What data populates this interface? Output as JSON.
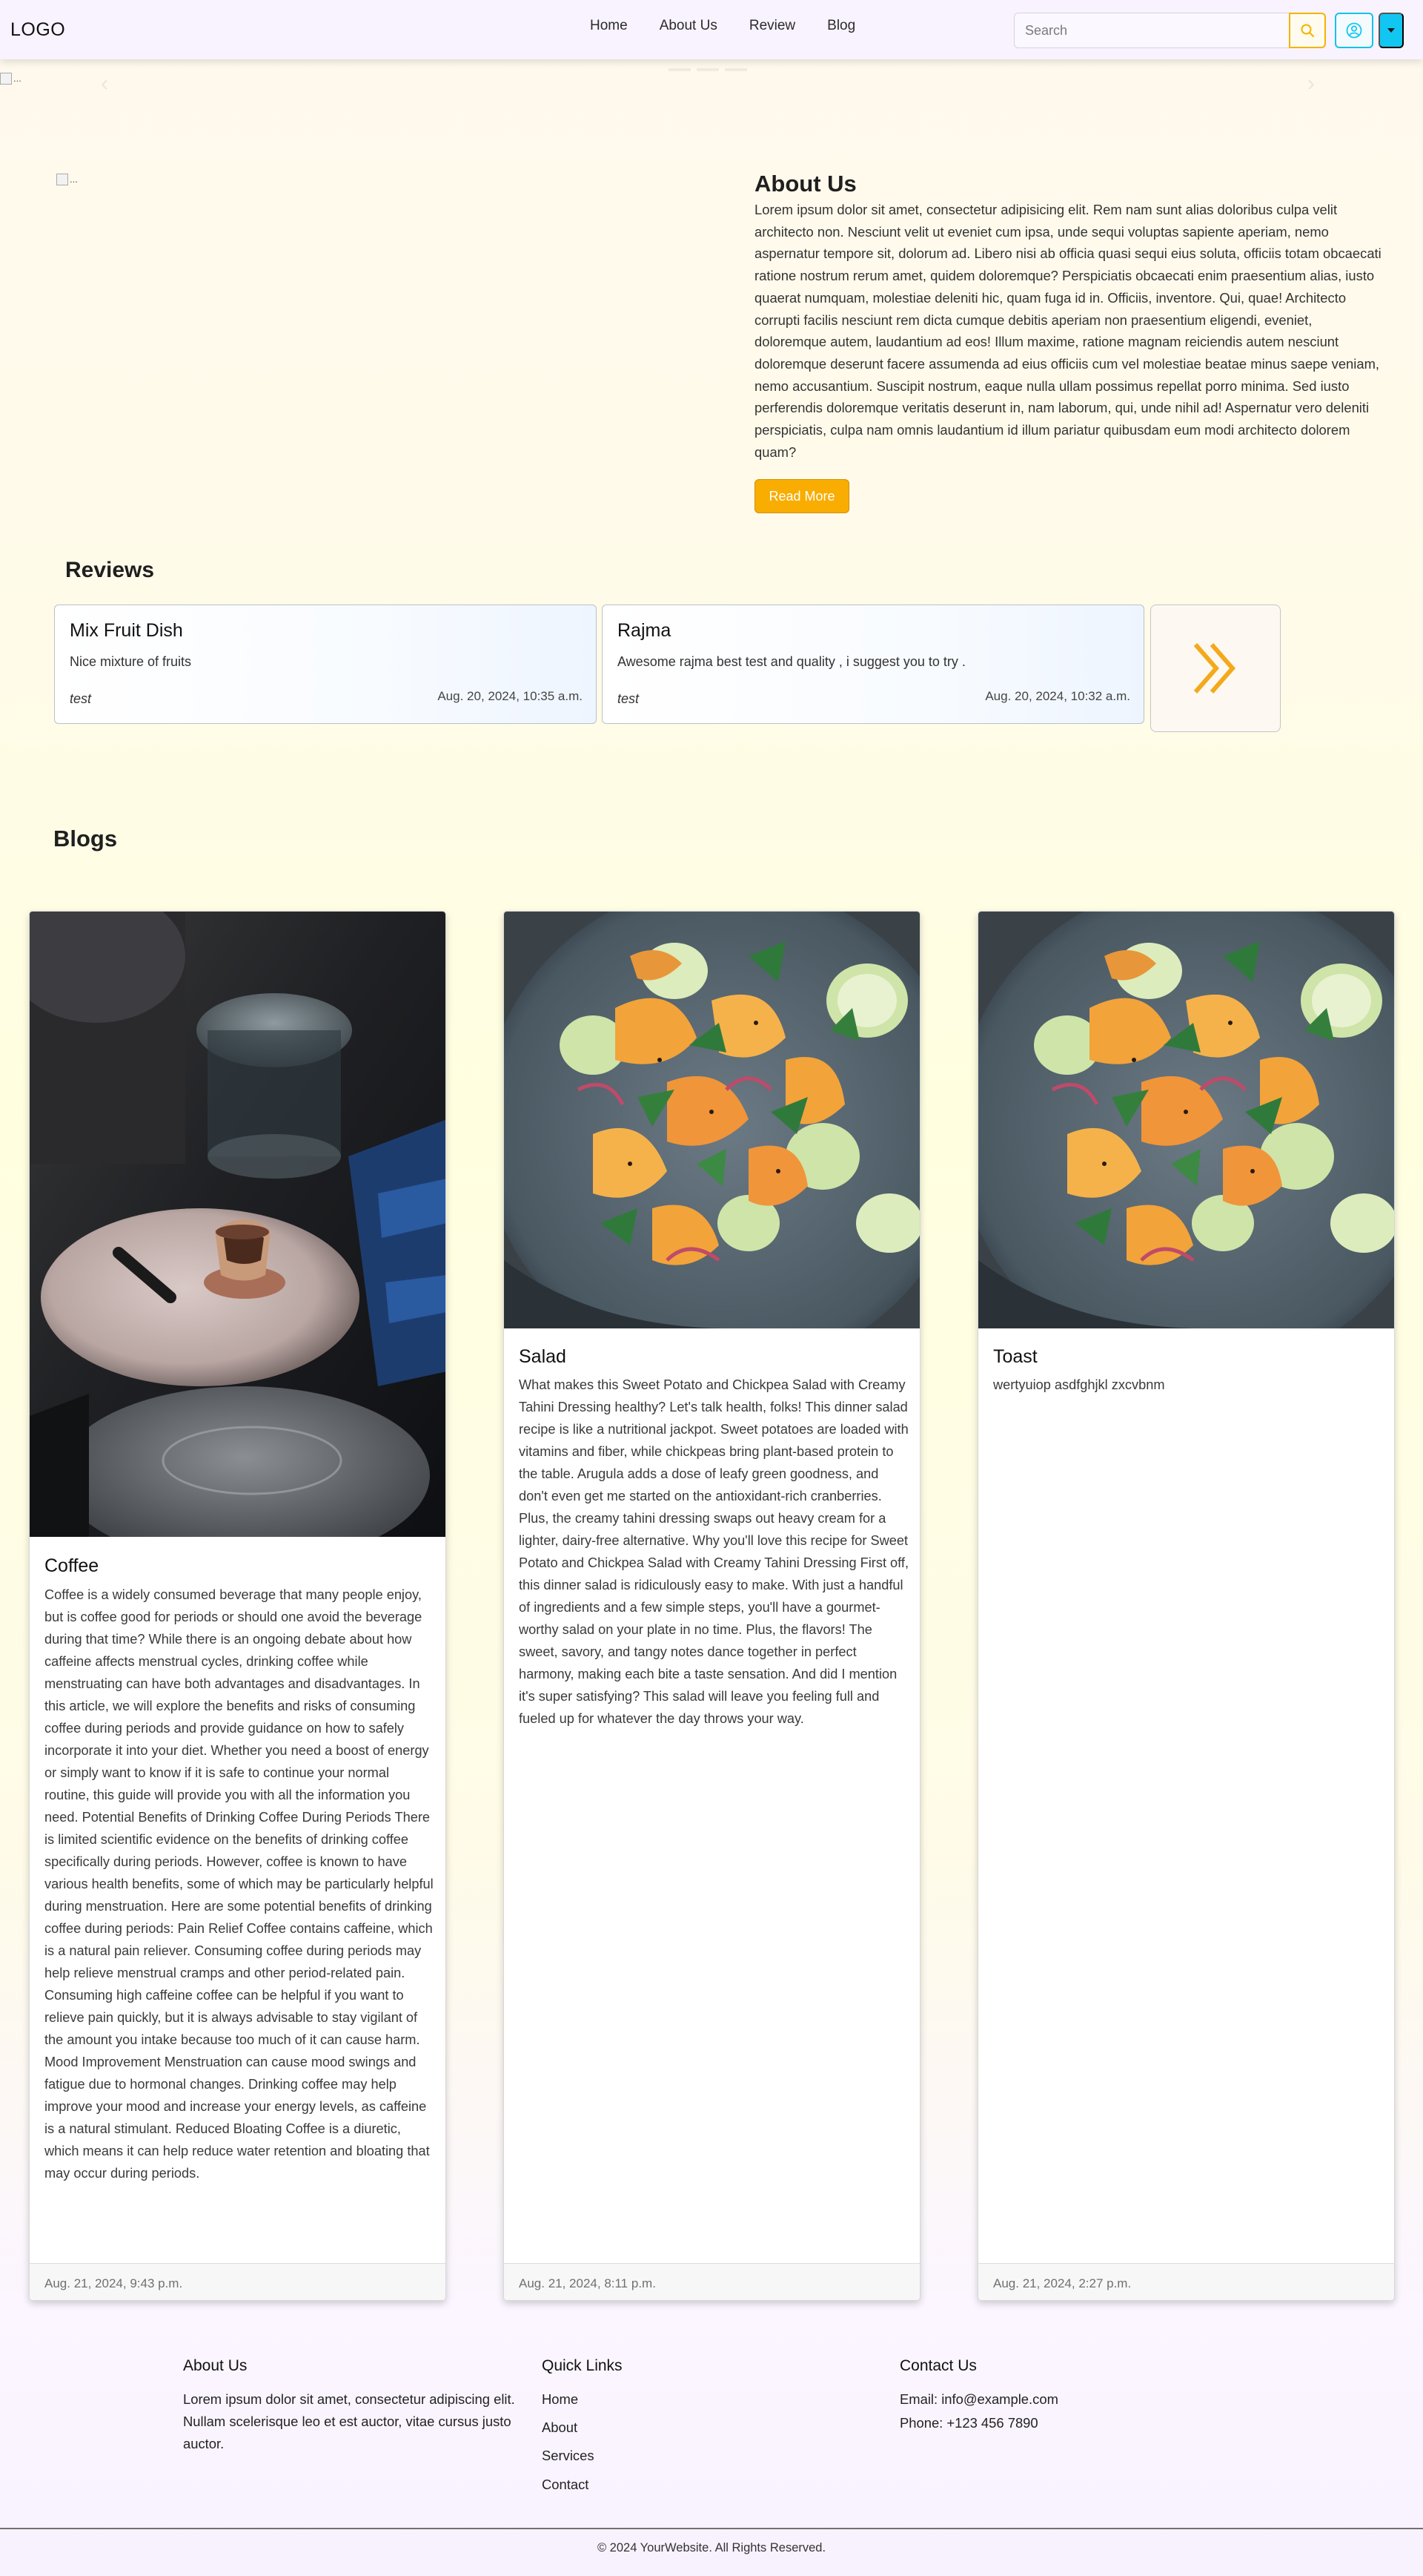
{
  "nav": {
    "logo": "LOGO",
    "links": [
      "Home",
      "About Us",
      "Review",
      "Blog"
    ],
    "search_placeholder": "Search",
    "search_icon": "search-icon",
    "user_icon": "user-circle-icon",
    "dropdown_icon": "caret-down-icon",
    "colors": {
      "accent": "#f4b400",
      "info": "#12c6f2",
      "bar": "#f8f3ff"
    }
  },
  "carousel": {
    "image_alt": "..."
  },
  "about": {
    "image_alt": "...",
    "title": "About Us",
    "text": "Lorem ipsum dolor sit amet, consectetur adipisicing elit. Rem nam sunt alias doloribus culpa velit architecto non. Nesciunt velit ut eveniet cum ipsa, unde sequi voluptas sapiente aperiam, nemo aspernatur tempore sit, dolorum ad. Libero nisi ab officia quasi sequi eius soluta, officiis totam obcaecati ratione nostrum rerum amet, quidem doloremque? Perspiciatis obcaecati enim praesentium alias, iusto quaerat numquam, molestiae deleniti hic, quam fuga id in. Officiis, inventore. Qui, quae! Architecto corrupti facilis nesciunt rem dicta cumque debitis aperiam non praesentium eligendi, eveniet, doloremque autem, laudantium ad eos! Illum maxime, ratione magnam reiciendis autem nesciunt doloremque deserunt facere assumenda ad eius officiis cum vel molestiae beatae minus saepe veniam, nemo accusantium. Suscipit nostrum, eaque nulla ullam possimus repellat porro minima. Sed iusto perferendis doloremque veritatis deserunt in, nam laborum, qui, unde nihil ad! Aspernatur vero deleniti perspiciatis, culpa nam omnis laudantium id illum pariatur quibusdam eum modi architecto dolorem quam?",
    "button": "Read More",
    "button_color": "#f8ad00"
  },
  "reviews": {
    "title": "Reviews",
    "items": [
      {
        "name": "Mix Fruit Dish",
        "text": "Nice mixture of fruits",
        "user": "test",
        "date": "Aug. 20, 2024, 10:35 a.m."
      },
      {
        "name": "Rajma",
        "text": "Awesome rajma best test and quality , i suggest you to try .",
        "user": "test",
        "date": "Aug. 20, 2024, 10:32 a.m."
      }
    ],
    "next_icon": "double-chevron-right-icon"
  },
  "blogs": {
    "title": "Blogs",
    "items": [
      {
        "title": "Coffee",
        "image": "coffee-cup-photo",
        "text": "Coffee is a widely consumed beverage that many people enjoy, but is coffee good for periods or should one avoid the beverage during that time? While there is an ongoing debate about how caffeine affects menstrual cycles, drinking coffee while menstruating can have both advantages and disadvantages. In this article, we will explore the benefits and risks of consuming coffee during periods and provide guidance on how to safely incorporate it into your diet. Whether you need a boost of energy or simply want to know if it is safe to continue your normal routine, this guide will provide you with all the information you need. Potential Benefits of Drinking Coffee During Periods There is limited scientific evidence on the benefits of drinking coffee specifically during periods. However, coffee is known to have various health benefits, some of which may be particularly helpful during menstruation. Here are some potential benefits of drinking coffee during periods: Pain Relief Coffee contains caffeine, which is a natural pain reliever. Consuming coffee during periods may help relieve menstrual cramps and other period-related pain. Consuming high caffeine coffee can be helpful if you want to relieve pain quickly, but it is always advisable to stay vigilant of the amount you intake because too much of it can cause harm. Mood Improvement Menstruation can cause mood swings and fatigue due to hormonal changes. Drinking coffee may help improve your mood and increase your energy levels, as caffeine is a natural stimulant. Reduced Bloating Coffee is a diuretic, which means it can help reduce water retention and bloating that may occur during periods.",
        "date": "Aug. 21, 2024, 9:43 p.m."
      },
      {
        "title": "Salad",
        "image": "salad-bowl-photo",
        "text": "What makes this Sweet Potato and Chickpea Salad with Creamy Tahini Dressing healthy? Let's talk health, folks! This dinner salad recipe is like a nutritional jackpot. Sweet potatoes are loaded with vitamins and fiber, while chickpeas bring plant-based protein to the table. Arugula adds a dose of leafy green goodness, and don't even get me started on the antioxidant-rich cranberries. Plus, the creamy tahini dressing swaps out heavy cream for a lighter, dairy-free alternative. Why you'll love this recipe for Sweet Potato and Chickpea Salad with Creamy Tahini Dressing First off, this dinner salad is ridiculously easy to make. With just a handful of ingredients and a few simple steps, you'll have a gourmet-worthy salad on your plate in no time. Plus, the flavors! The sweet, savory, and tangy notes dance together in perfect harmony, making each bite a taste sensation. And did I mention it's super satisfying? This salad will leave you feeling full and fueled up for whatever the day throws your way.",
        "date": "Aug. 21, 2024, 8:11 p.m."
      },
      {
        "title": "Toast",
        "image": "salad-bowl-photo",
        "text": "wertyuiop asdfghjkl zxcvbnm",
        "date": "Aug. 21, 2024, 2:27 p.m."
      }
    ]
  },
  "footer": {
    "about_title": "About Us",
    "about_text": "Lorem ipsum dolor sit amet, consectetur adipiscing elit. Nullam scelerisque leo et est auctor, vitae cursus justo auctor.",
    "links_title": "Quick Links",
    "links": [
      "Home",
      "About",
      "Services",
      "Contact"
    ],
    "contact_title": "Contact Us",
    "email": "Email: info@example.com",
    "phone": "Phone: +123 456 7890",
    "copyright": "© 2024 YourWebsite. All Rights Reserved."
  }
}
